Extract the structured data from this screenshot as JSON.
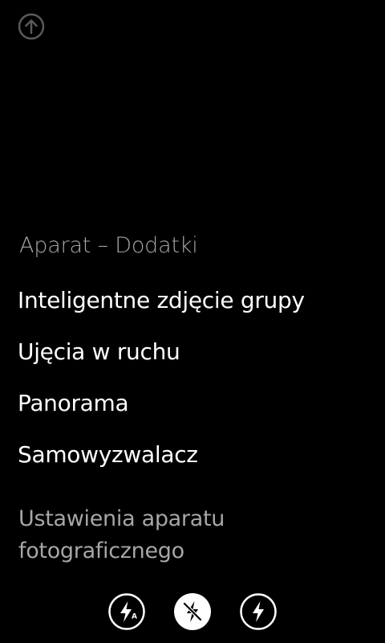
{
  "navigation": {
    "back_icon": "arrow-up-circle-icon"
  },
  "menu": {
    "title": "Aparat – Dodatki",
    "items": [
      {
        "label": "Inteligentne zdjęcie grupy"
      },
      {
        "label": "Ujęcia w ruchu"
      },
      {
        "label": "Panorama"
      },
      {
        "label": "Samowyzwalacz"
      }
    ],
    "settings_label": "Ustawienia aparatu fotograficznego"
  },
  "flash_modes": [
    {
      "icon": "flash-auto-icon",
      "state": "unselected",
      "badge": "A"
    },
    {
      "icon": "flash-off-icon",
      "state": "selected"
    },
    {
      "icon": "flash-on-icon",
      "state": "unselected"
    }
  ],
  "colors": {
    "background": "#000000",
    "primary_text": "#ffffff",
    "secondary_text": "#a6a6a6"
  }
}
